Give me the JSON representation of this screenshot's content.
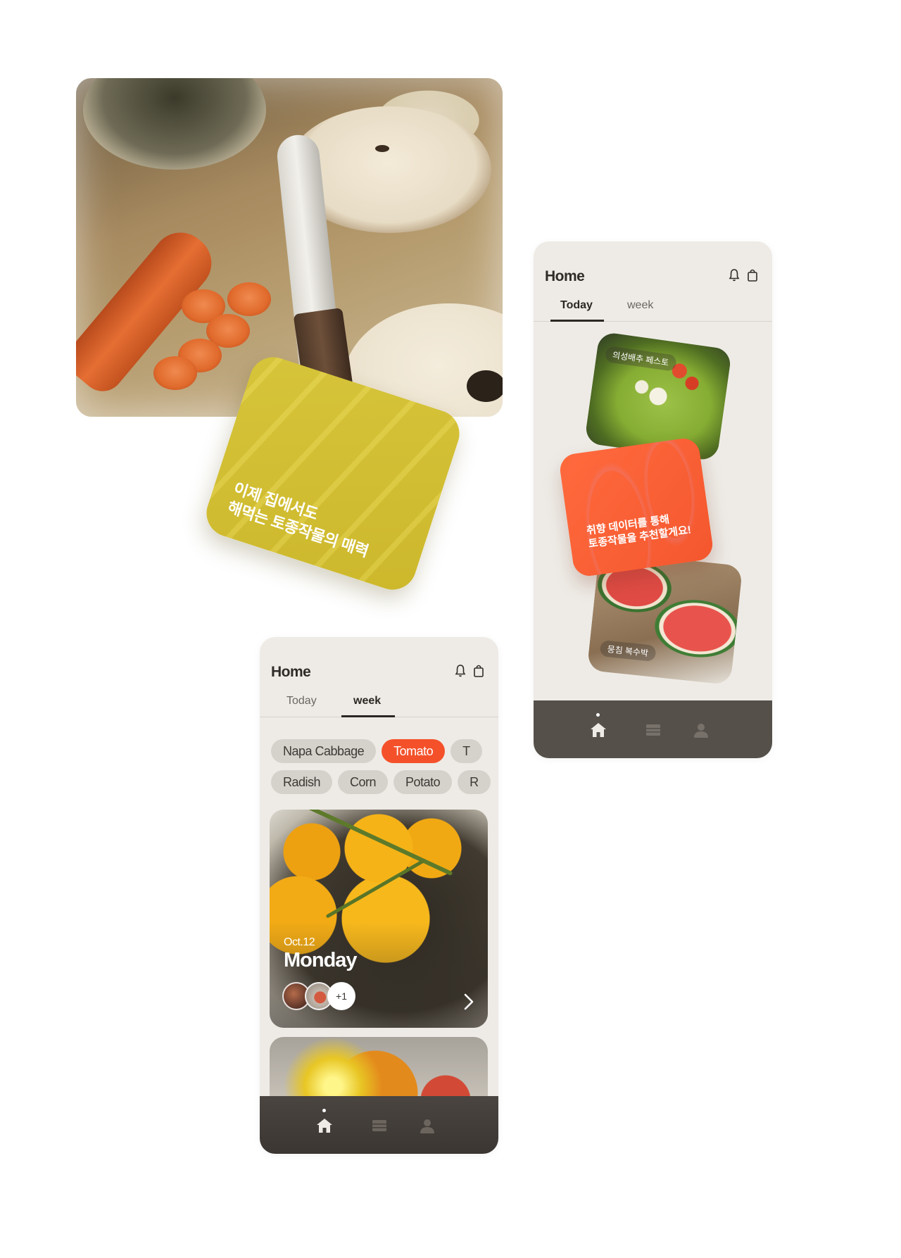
{
  "hero": {
    "tagline_line1": "이제 집에서도",
    "tagline_line2": "해먹는 토종작물의 매력"
  },
  "phone_today": {
    "header": {
      "title": "Home"
    },
    "tabs": [
      {
        "label": "Today",
        "active": true
      },
      {
        "label": "week",
        "active": false
      }
    ],
    "cards": {
      "top_label": "의성배추 페스토",
      "main_line1": "취향 데이터를 통해",
      "main_line2": "토종작물을 추천할게요!",
      "bottom_label": "뭉침 복수박"
    },
    "bottom_nav": {
      "active": "home",
      "items": [
        "home-icon",
        "list-icon",
        "user-icon"
      ]
    }
  },
  "phone_week": {
    "header": {
      "title": "Home"
    },
    "tabs": [
      {
        "label": "Today",
        "active": false
      },
      {
        "label": "week",
        "active": true
      }
    ],
    "chips_row1": [
      "Napa Cabbage",
      "Tomato",
      "T"
    ],
    "chips_row2": [
      "Radish",
      "Corn",
      "Potato",
      "R"
    ],
    "active_chip": "Tomato",
    "feature_card": {
      "date": "Oct.12",
      "day": "Monday",
      "more_count": "+1"
    },
    "bottom_nav": {
      "active": "home",
      "items": [
        "home-icon",
        "list-icon",
        "user-icon"
      ]
    }
  },
  "colors": {
    "accent": "#f4512a",
    "card_yellow": "#d2bf35",
    "phone_bg": "#eeebe6",
    "nav_bg": "#55504a"
  }
}
